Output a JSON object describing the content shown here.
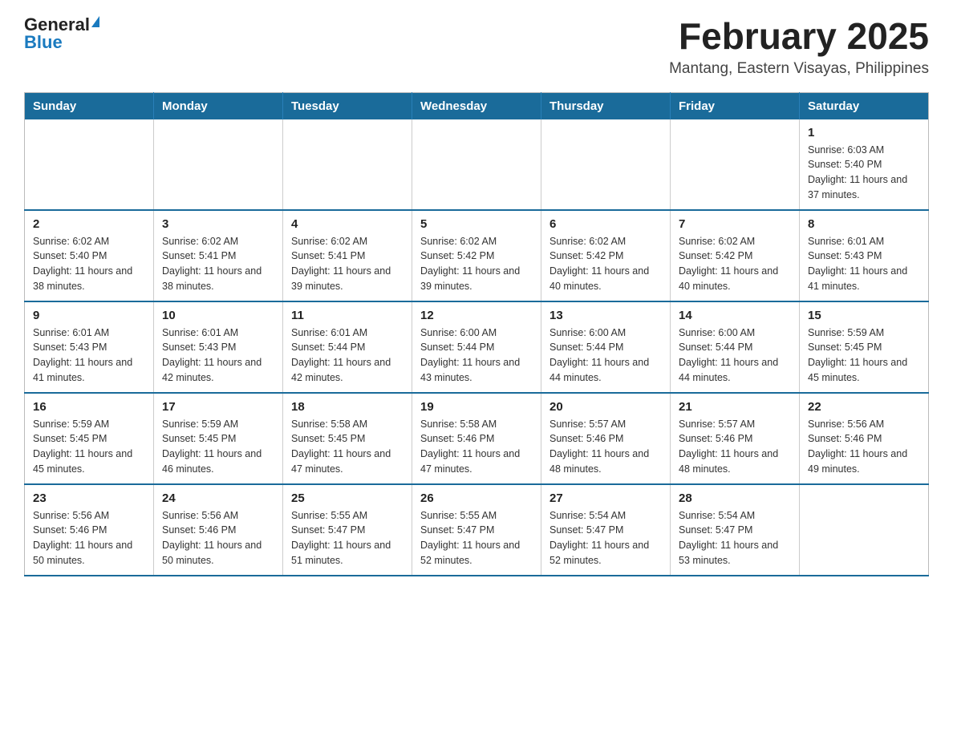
{
  "logo": {
    "general": "General",
    "blue": "Blue"
  },
  "header": {
    "month_title": "February 2025",
    "location": "Mantang, Eastern Visayas, Philippines"
  },
  "weekdays": [
    "Sunday",
    "Monday",
    "Tuesday",
    "Wednesday",
    "Thursday",
    "Friday",
    "Saturday"
  ],
  "weeks": [
    [
      {
        "day": "",
        "info": ""
      },
      {
        "day": "",
        "info": ""
      },
      {
        "day": "",
        "info": ""
      },
      {
        "day": "",
        "info": ""
      },
      {
        "day": "",
        "info": ""
      },
      {
        "day": "",
        "info": ""
      },
      {
        "day": "1",
        "info": "Sunrise: 6:03 AM\nSunset: 5:40 PM\nDaylight: 11 hours and 37 minutes."
      }
    ],
    [
      {
        "day": "2",
        "info": "Sunrise: 6:02 AM\nSunset: 5:40 PM\nDaylight: 11 hours and 38 minutes."
      },
      {
        "day": "3",
        "info": "Sunrise: 6:02 AM\nSunset: 5:41 PM\nDaylight: 11 hours and 38 minutes."
      },
      {
        "day": "4",
        "info": "Sunrise: 6:02 AM\nSunset: 5:41 PM\nDaylight: 11 hours and 39 minutes."
      },
      {
        "day": "5",
        "info": "Sunrise: 6:02 AM\nSunset: 5:42 PM\nDaylight: 11 hours and 39 minutes."
      },
      {
        "day": "6",
        "info": "Sunrise: 6:02 AM\nSunset: 5:42 PM\nDaylight: 11 hours and 40 minutes."
      },
      {
        "day": "7",
        "info": "Sunrise: 6:02 AM\nSunset: 5:42 PM\nDaylight: 11 hours and 40 minutes."
      },
      {
        "day": "8",
        "info": "Sunrise: 6:01 AM\nSunset: 5:43 PM\nDaylight: 11 hours and 41 minutes."
      }
    ],
    [
      {
        "day": "9",
        "info": "Sunrise: 6:01 AM\nSunset: 5:43 PM\nDaylight: 11 hours and 41 minutes."
      },
      {
        "day": "10",
        "info": "Sunrise: 6:01 AM\nSunset: 5:43 PM\nDaylight: 11 hours and 42 minutes."
      },
      {
        "day": "11",
        "info": "Sunrise: 6:01 AM\nSunset: 5:44 PM\nDaylight: 11 hours and 42 minutes."
      },
      {
        "day": "12",
        "info": "Sunrise: 6:00 AM\nSunset: 5:44 PM\nDaylight: 11 hours and 43 minutes."
      },
      {
        "day": "13",
        "info": "Sunrise: 6:00 AM\nSunset: 5:44 PM\nDaylight: 11 hours and 44 minutes."
      },
      {
        "day": "14",
        "info": "Sunrise: 6:00 AM\nSunset: 5:44 PM\nDaylight: 11 hours and 44 minutes."
      },
      {
        "day": "15",
        "info": "Sunrise: 5:59 AM\nSunset: 5:45 PM\nDaylight: 11 hours and 45 minutes."
      }
    ],
    [
      {
        "day": "16",
        "info": "Sunrise: 5:59 AM\nSunset: 5:45 PM\nDaylight: 11 hours and 45 minutes."
      },
      {
        "day": "17",
        "info": "Sunrise: 5:59 AM\nSunset: 5:45 PM\nDaylight: 11 hours and 46 minutes."
      },
      {
        "day": "18",
        "info": "Sunrise: 5:58 AM\nSunset: 5:45 PM\nDaylight: 11 hours and 47 minutes."
      },
      {
        "day": "19",
        "info": "Sunrise: 5:58 AM\nSunset: 5:46 PM\nDaylight: 11 hours and 47 minutes."
      },
      {
        "day": "20",
        "info": "Sunrise: 5:57 AM\nSunset: 5:46 PM\nDaylight: 11 hours and 48 minutes."
      },
      {
        "day": "21",
        "info": "Sunrise: 5:57 AM\nSunset: 5:46 PM\nDaylight: 11 hours and 48 minutes."
      },
      {
        "day": "22",
        "info": "Sunrise: 5:56 AM\nSunset: 5:46 PM\nDaylight: 11 hours and 49 minutes."
      }
    ],
    [
      {
        "day": "23",
        "info": "Sunrise: 5:56 AM\nSunset: 5:46 PM\nDaylight: 11 hours and 50 minutes."
      },
      {
        "day": "24",
        "info": "Sunrise: 5:56 AM\nSunset: 5:46 PM\nDaylight: 11 hours and 50 minutes."
      },
      {
        "day": "25",
        "info": "Sunrise: 5:55 AM\nSunset: 5:47 PM\nDaylight: 11 hours and 51 minutes."
      },
      {
        "day": "26",
        "info": "Sunrise: 5:55 AM\nSunset: 5:47 PM\nDaylight: 11 hours and 52 minutes."
      },
      {
        "day": "27",
        "info": "Sunrise: 5:54 AM\nSunset: 5:47 PM\nDaylight: 11 hours and 52 minutes."
      },
      {
        "day": "28",
        "info": "Sunrise: 5:54 AM\nSunset: 5:47 PM\nDaylight: 11 hours and 53 minutes."
      },
      {
        "day": "",
        "info": ""
      }
    ]
  ]
}
